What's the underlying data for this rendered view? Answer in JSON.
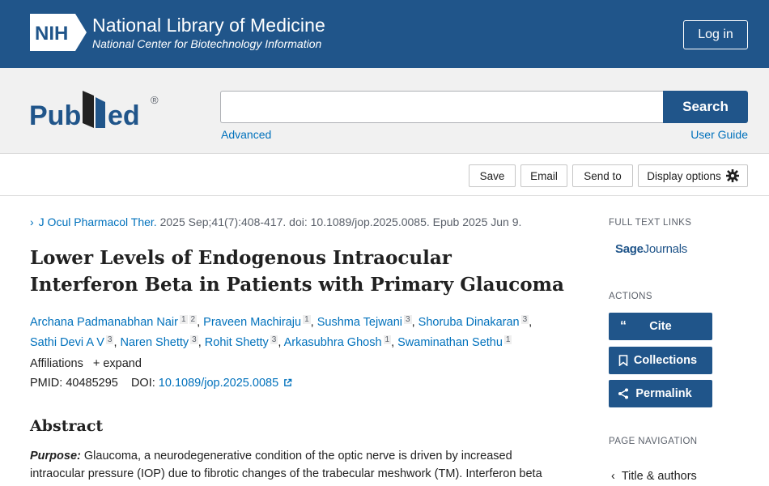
{
  "header": {
    "nih_logo_text": "NIH",
    "org_title": "National Library of Medicine",
    "org_subtitle": "National Center for Biotechnology Information",
    "login_label": "Log in"
  },
  "search": {
    "logo_text": "PubMed",
    "logo_mark": "®",
    "query_value": "",
    "placeholder": "",
    "button_label": "Search",
    "advanced_label": "Advanced",
    "user_guide_label": "User Guide"
  },
  "toolbar": {
    "save_label": "Save",
    "email_label": "Email",
    "send_to_label": "Send to",
    "display_options_label": "Display options",
    "display_options_icon": "gear-icon"
  },
  "article": {
    "journal": "J Ocul Pharmacol Ther.",
    "citation_rest": "2025 Sep;41(7):408-417. doi: 10.1089/jop.2025.0085. Epub 2025 Jun 9.",
    "title": "Lower Levels of Endogenous Intraocular Interferon Beta in Patients with Primary Glaucoma",
    "authors": [
      {
        "name": "Archana Padmanabhan Nair",
        "affs": [
          "1",
          "2"
        ]
      },
      {
        "name": "Praveen Machiraju",
        "affs": [
          "1"
        ]
      },
      {
        "name": "Sushma Tejwani",
        "affs": [
          "3"
        ]
      },
      {
        "name": "Shoruba Dinakaran",
        "affs": [
          "3"
        ]
      },
      {
        "name": "Sathi Devi A V",
        "affs": [
          "3"
        ]
      },
      {
        "name": "Naren Shetty",
        "affs": [
          "3"
        ]
      },
      {
        "name": "Rohit Shetty",
        "affs": [
          "3"
        ]
      },
      {
        "name": "Arkasubhra Ghosh",
        "affs": [
          "1"
        ]
      },
      {
        "name": "Swaminathan Sethu",
        "affs": [
          "1"
        ]
      }
    ],
    "affiliations_label": "Affiliations",
    "expand_label": "expand",
    "pmid_label": "PMID:",
    "pmid_value": "40485295",
    "doi_label": "DOI:",
    "doi_value": "10.1089/jop.2025.0085",
    "abstract_heading": "Abstract",
    "abstract_purpose_label": "Purpose:",
    "abstract_text": "Glaucoma, a neurodegenerative condition of the optic nerve is driven by increased intraocular pressure (IOP) due to fibrotic changes of the trabecular meshwork (TM). Interferon beta"
  },
  "sidebar": {
    "full_text_heading": "FULL TEXT LINKS",
    "sage_bold": "Sage",
    "sage_rest": "Journals",
    "actions_heading": "ACTIONS",
    "cite_label": "Cite",
    "cite_icon_glyph": "“",
    "collections_label": "Collections",
    "permalink_label": "Permalink",
    "page_nav_heading": "PAGE NAVIGATION",
    "nav_title_authors": "Title & authors"
  }
}
